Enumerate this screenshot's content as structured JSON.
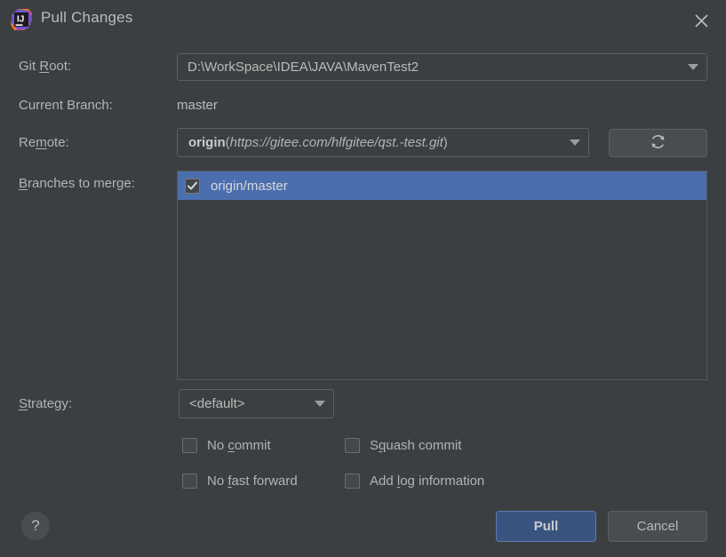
{
  "window": {
    "title": "Pull Changes",
    "app_icon": "intellij-idea-logo",
    "close_icon": "close-icon"
  },
  "fields": {
    "git_root": {
      "label_prefix": "Git ",
      "label_mnemonic": "R",
      "label_suffix": "oot:",
      "value": "D:\\WorkSpace\\IDEA\\JAVA\\MavenTest2",
      "dropdown_icon": "chevron-down-icon"
    },
    "current_branch": {
      "label": "Current Branch:",
      "value": "master"
    },
    "remote": {
      "label_prefix": "Re",
      "label_mnemonic": "m",
      "label_suffix": "ote:",
      "name": "origin",
      "open_paren": "(",
      "url": "https://gitee.com/hlfgitee/qst.-test.git",
      "close_paren": ")",
      "dropdown_icon": "chevron-down-icon",
      "refresh_icon": "refresh-icon"
    },
    "branches_to_merge": {
      "label_prefix": "",
      "label_mnemonic": "B",
      "label_suffix": "ranches to merge:",
      "items": [
        {
          "label": "origin/master",
          "checked": true,
          "selected": true
        }
      ]
    },
    "strategy": {
      "label_prefix": "",
      "label_mnemonic": "S",
      "label_suffix": "trategy:",
      "value": "<default>",
      "dropdown_icon": "chevron-down-icon"
    }
  },
  "options": [
    {
      "id": "no-commit",
      "prefix": "No ",
      "mnemonic": "c",
      "suffix": "ommit",
      "checked": false
    },
    {
      "id": "squash-commit",
      "prefix": "S",
      "mnemonic": "q",
      "suffix": "uash commit",
      "checked": false
    },
    {
      "id": "no-ff",
      "prefix": "No ",
      "mnemonic": "f",
      "suffix": "ast forward",
      "checked": false
    },
    {
      "id": "add-log",
      "prefix": "Add ",
      "mnemonic": "l",
      "suffix": "og information",
      "checked": false
    }
  ],
  "footer": {
    "help_label": "?",
    "help_icon": "question-mark-icon",
    "pull_label": "Pull",
    "cancel_label": "Cancel"
  },
  "colors": {
    "background": "#3c3f41",
    "selection": "#4b6eaf",
    "default_button": "#39547e",
    "border": "#5e6060",
    "text": "#b0b3b8"
  }
}
